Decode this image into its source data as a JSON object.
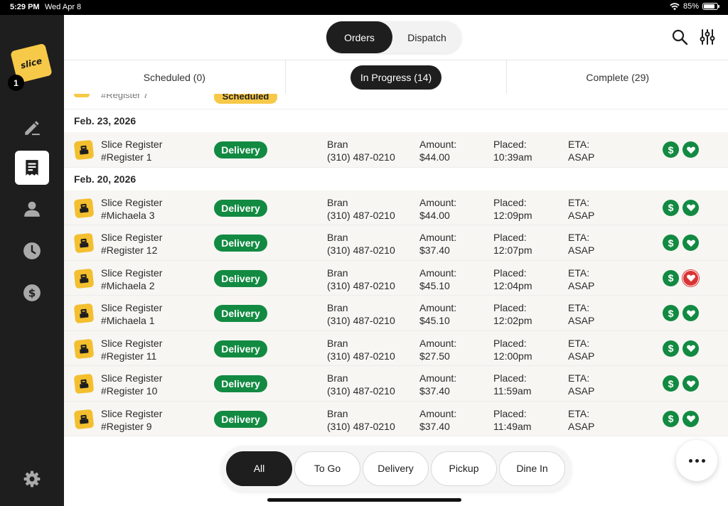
{
  "status": {
    "time": "5:29 PM",
    "date": "Wed Apr 8",
    "battery": "85%",
    "battery_level": 0.85
  },
  "sidebar": {
    "logo_text": "slice",
    "badge_count": "1",
    "items": [
      {
        "name": "edit",
        "icon": "pencil-icon"
      },
      {
        "name": "orders",
        "icon": "receipt-icon",
        "active": true
      },
      {
        "name": "customers",
        "icon": "person-icon"
      },
      {
        "name": "history",
        "icon": "clock-icon"
      },
      {
        "name": "payments",
        "icon": "dollar-icon"
      },
      {
        "name": "settings",
        "icon": "gear-icon"
      }
    ]
  },
  "header": {
    "segments": [
      "Orders",
      "Dispatch"
    ],
    "active_segment": "Orders"
  },
  "tabs": [
    "Scheduled (0)",
    "In Progress (14)",
    "Complete (29)"
  ],
  "active_tab": "In Progress (14)",
  "partial_row": {
    "register": "#Register 7",
    "badge": "Scheduled"
  },
  "groups": [
    {
      "date": "Feb. 23, 2026",
      "orders": [
        {
          "name": "Slice Register",
          "register": "#Register 1",
          "type": "Delivery",
          "customer": "Bran",
          "phone": "(310) 487-0210",
          "amount_label": "Amount:",
          "amount": "$44.00",
          "placed_label": "Placed:",
          "placed": "10:39am",
          "eta_label": "ETA:",
          "eta": "ASAP",
          "heart_alert": false
        }
      ]
    },
    {
      "date": "Feb. 20, 2026",
      "orders": [
        {
          "name": "Slice Register",
          "register": "#Michaela 3",
          "type": "Delivery",
          "customer": "Bran",
          "phone": "(310) 487-0210",
          "amount_label": "Amount:",
          "amount": "$44.00",
          "placed_label": "Placed:",
          "placed": "12:09pm",
          "eta_label": "ETA:",
          "eta": "ASAP",
          "heart_alert": false
        },
        {
          "name": "Slice Register",
          "register": "#Register 12",
          "type": "Delivery",
          "customer": "Bran",
          "phone": "(310) 487-0210",
          "amount_label": "Amount:",
          "amount": "$37.40",
          "placed_label": "Placed:",
          "placed": "12:07pm",
          "eta_label": "ETA:",
          "eta": "ASAP",
          "heart_alert": false
        },
        {
          "name": "Slice Register",
          "register": "#Michaela 2",
          "type": "Delivery",
          "customer": "Bran",
          "phone": "(310) 487-0210",
          "amount_label": "Amount:",
          "amount": "$45.10",
          "placed_label": "Placed:",
          "placed": "12:04pm",
          "eta_label": "ETA:",
          "eta": "ASAP",
          "heart_alert": true
        },
        {
          "name": "Slice Register",
          "register": "#Michaela 1",
          "type": "Delivery",
          "customer": "Bran",
          "phone": "(310) 487-0210",
          "amount_label": "Amount:",
          "amount": "$45.10",
          "placed_label": "Placed:",
          "placed": "12:02pm",
          "eta_label": "ETA:",
          "eta": "ASAP",
          "heart_alert": false
        },
        {
          "name": "Slice Register",
          "register": "#Register 11",
          "type": "Delivery",
          "customer": "Bran",
          "phone": "(310) 487-0210",
          "amount_label": "Amount:",
          "amount": "$27.50",
          "placed_label": "Placed:",
          "placed": "12:00pm",
          "eta_label": "ETA:",
          "eta": "ASAP",
          "heart_alert": false
        },
        {
          "name": "Slice Register",
          "register": "#Register 10",
          "type": "Delivery",
          "customer": "Bran",
          "phone": "(310) 487-0210",
          "amount_label": "Amount:",
          "amount": "$37.40",
          "placed_label": "Placed:",
          "placed": "11:59am",
          "eta_label": "ETA:",
          "eta": "ASAP",
          "heart_alert": false
        },
        {
          "name": "Slice Register",
          "register": "#Register 9",
          "type": "Delivery",
          "customer": "Bran",
          "phone": "(310) 487-0210",
          "amount_label": "Amount:",
          "amount": "$37.40",
          "placed_label": "Placed:",
          "placed": "11:49am",
          "eta_label": "ETA:",
          "eta": "ASAP",
          "heart_alert": false
        }
      ]
    }
  ],
  "filters": [
    "All",
    "To Go",
    "Delivery",
    "Pickup",
    "Dine In"
  ],
  "active_filter": "All",
  "colors": {
    "accent": "#f7c948",
    "delivery_green": "#128a42",
    "alert_red": "#d93434",
    "dark": "#1e1e1e"
  }
}
